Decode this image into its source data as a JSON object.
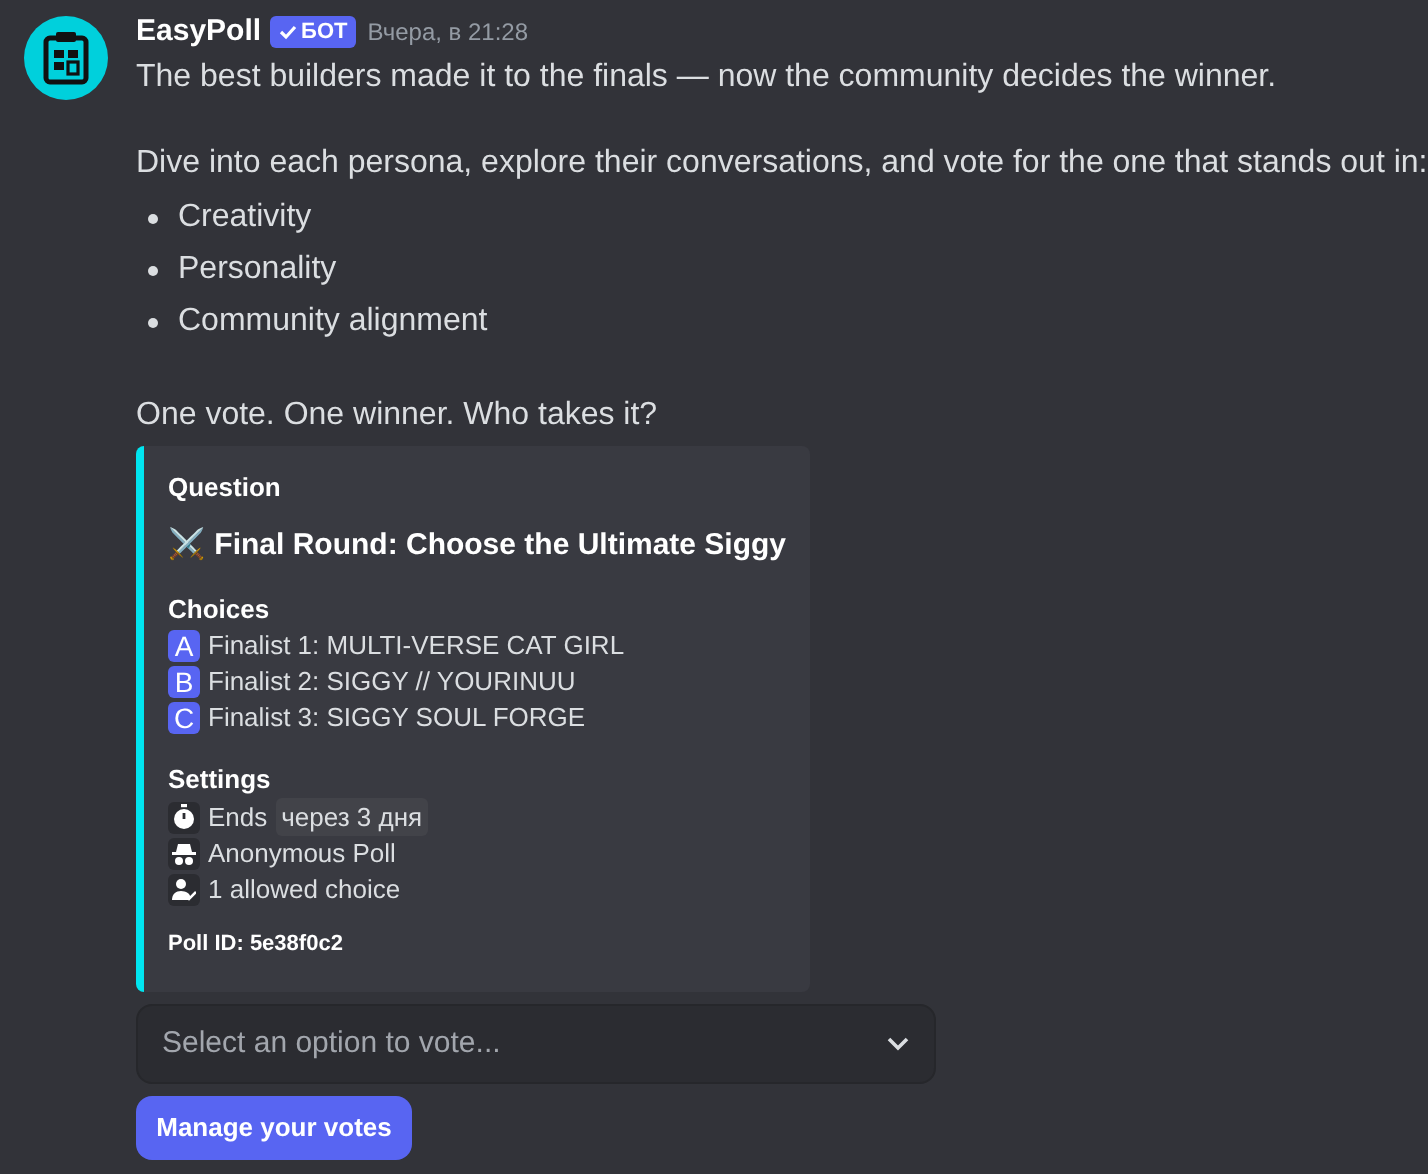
{
  "message": {
    "author": "EasyPoll",
    "badge": "БОТ",
    "timestamp": "Вчера, в 21:28",
    "paragraphs": [
      "The best builders made it to the finals — now the community decides the winner.",
      "Dive into each persona, explore their conversations, and vote for the one that stands out in:"
    ],
    "bullets": [
      "Creativity",
      "Personality",
      "Community alignment"
    ],
    "closing": "One vote. One winner. Who takes it?"
  },
  "embed": {
    "color": "#00e5f0",
    "question_label": "Question",
    "question": "⚔️ Final Round: Choose the Ultimate Siggy",
    "choices_label": "Choices",
    "choices": [
      {
        "letter": "A",
        "text": "Finalist 1: MULTI-VERSE CAT GIRL"
      },
      {
        "letter": "B",
        "text": "Finalist 2: SIGGY // YOURINUU"
      },
      {
        "letter": "C",
        "text": "Finalist 3: SIGGY SOUL FORGE"
      }
    ],
    "settings_label": "Settings",
    "settings": [
      {
        "kind": "timer",
        "text": "Ends",
        "time": "через 3 дня"
      },
      {
        "kind": "anonymous",
        "text": "Anonymous Poll"
      },
      {
        "kind": "choice",
        "text": "1 allowed choice"
      }
    ],
    "footer": "Poll ID: 5e38f0c2"
  },
  "select": {
    "placeholder": "Select an option to vote..."
  },
  "button": "Manage your votes"
}
